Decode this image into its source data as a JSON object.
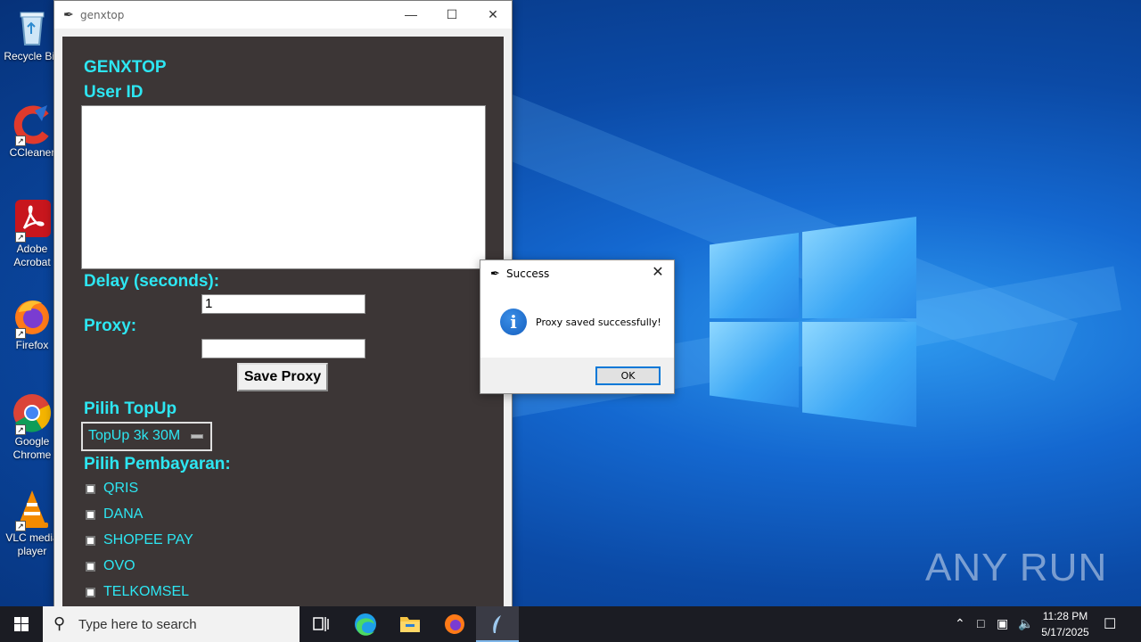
{
  "desktop": {
    "icons": [
      {
        "label": "Recycle Bin",
        "icon": "recycle-bin-icon"
      },
      {
        "label": "CCleaner",
        "icon": "ccleaner-icon"
      },
      {
        "label": "Adobe Acrobat",
        "icon": "adobe-acrobat-icon"
      },
      {
        "label": "Firefox",
        "icon": "firefox-icon"
      },
      {
        "label": "Google Chrome",
        "icon": "chrome-icon"
      },
      {
        "label": "VLC media player",
        "icon": "vlc-icon"
      }
    ]
  },
  "app": {
    "title": "genxtop",
    "heading": "GENXTOP",
    "user_id_label": "User ID",
    "user_id_value": "",
    "delay_label": "Delay (seconds):",
    "delay_value": "1",
    "proxy_label": "Proxy:",
    "proxy_value": "",
    "save_proxy_label": "Save Proxy",
    "topup_label": "Pilih TopUp",
    "topup_selected": "TopUp 3k 30M",
    "payment_label": "Pilih Pembayaran:",
    "payment_options": [
      "QRIS",
      "DANA",
      "SHOPEE PAY",
      "OVO",
      "TELKOMSEL"
    ]
  },
  "dialog": {
    "title": "Success",
    "message": "Proxy saved successfully!",
    "ok_label": "OK"
  },
  "watermark": "ANY RUN",
  "taskbar": {
    "search_placeholder": "Type here to search",
    "time": "11:28 PM",
    "date": "5/17/2025"
  },
  "colors": {
    "app_bg": "#3c3636",
    "label_cyan": "#2de6f2",
    "accent_blue": "#0078d7"
  }
}
